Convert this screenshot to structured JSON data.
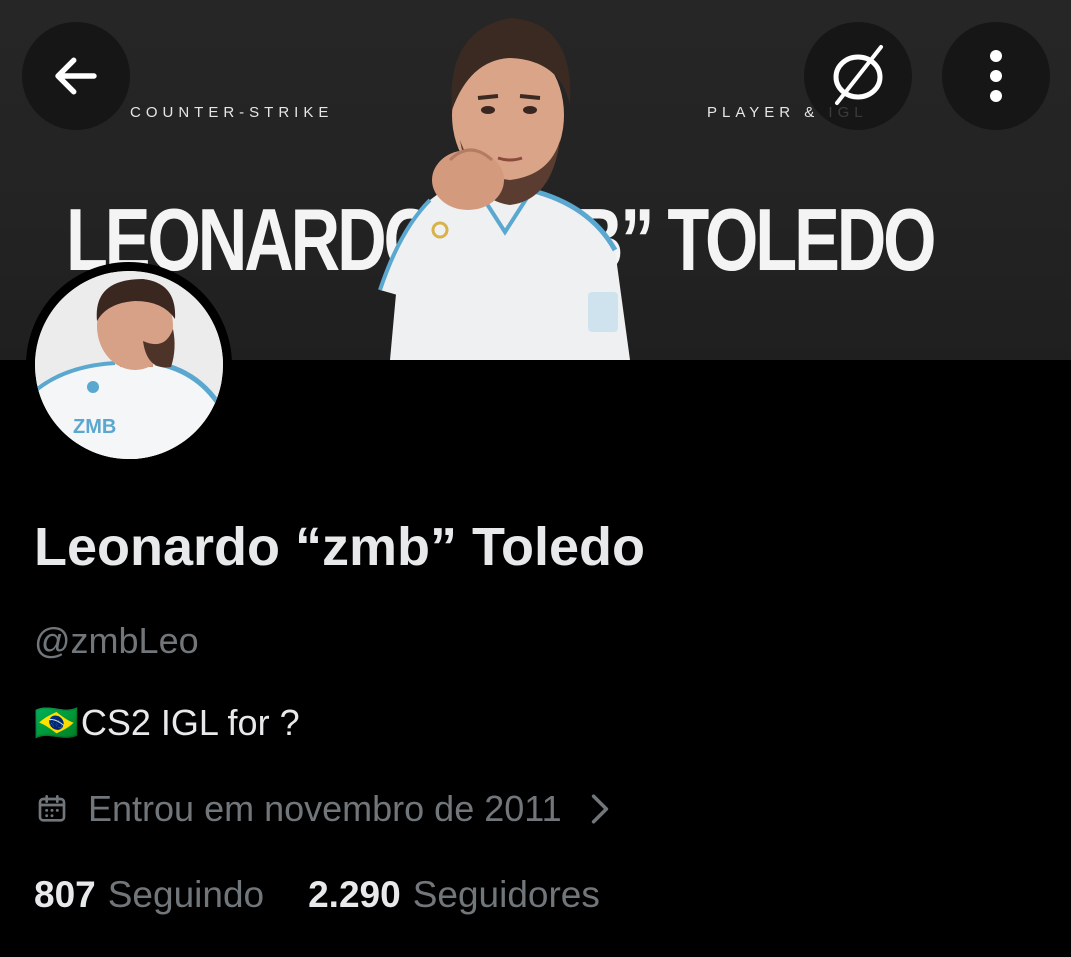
{
  "banner": {
    "caption_left": "COUNTER-STRIKE",
    "caption_right": "PLAYER & IGL",
    "title": "LEONARDO “ZMB” TOLEDO"
  },
  "header": {
    "back_icon": "arrow-left-icon",
    "brand_icon": "slashed-circle-logo-icon",
    "more_icon": "vertical-ellipsis-icon"
  },
  "avatar": {
    "jersey_text": "ZMB"
  },
  "profile": {
    "display_name": "Leonardo “zmb” Toledo",
    "handle": "@zmbLeo",
    "bio_flag": "🇧🇷",
    "bio_text": "CS2 IGL for ?",
    "joined": "Entrou em novembro de 2011"
  },
  "stats": {
    "following_count": "807",
    "following_label": "Seguindo",
    "followers_count": "2.290",
    "followers_label": "Seguidores"
  },
  "colors": {
    "background": "#000000",
    "banner": "#262626",
    "text_primary": "#e7e9ea",
    "text_secondary": "#71767b"
  }
}
